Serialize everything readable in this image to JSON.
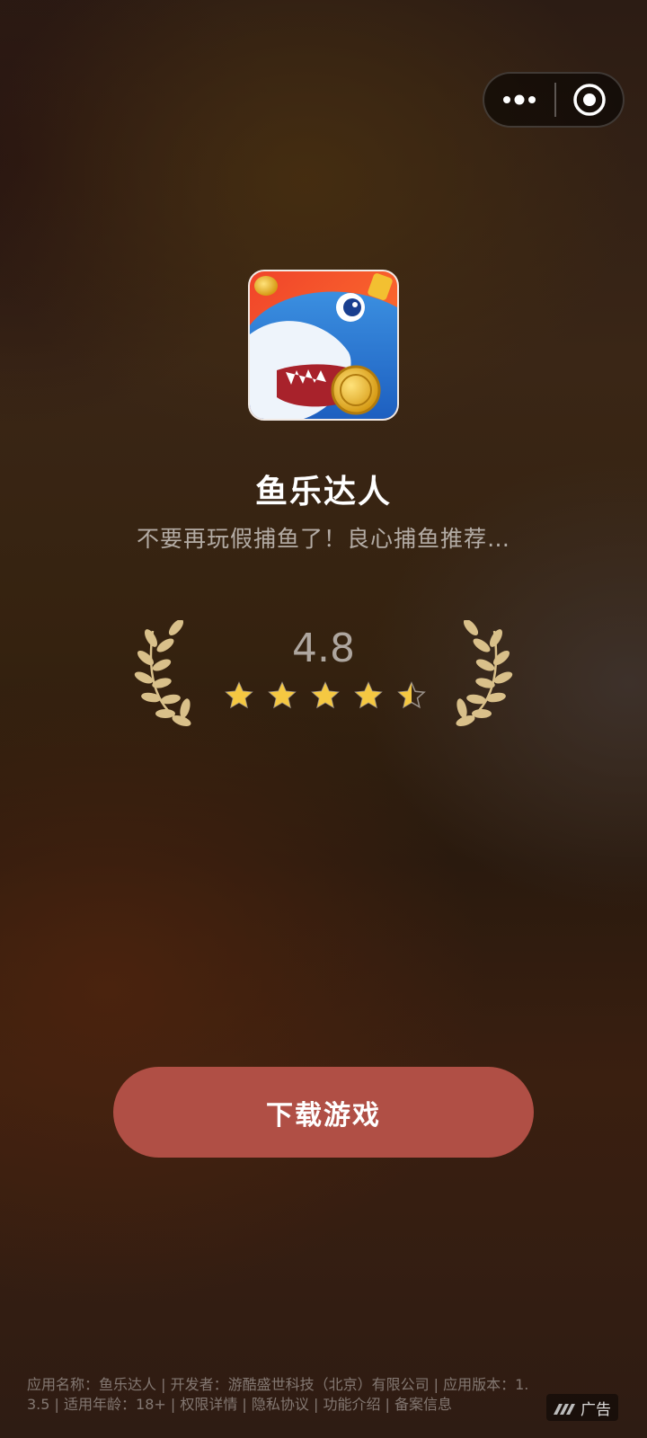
{
  "capsule": {
    "more_icon": "more-dots-icon",
    "close_icon": "target-close-icon"
  },
  "app": {
    "icon": "shark-coin-app-icon",
    "name": "鱼乐达人",
    "description": "不要再玩假捕鱼了！良心捕鱼推荐…"
  },
  "rating": {
    "value": "4.8",
    "stars_filled": 4.5,
    "stars_total": 5,
    "star_color": "#f5c842",
    "laurel_color": "#d9c08a"
  },
  "download": {
    "label": "下载游戏",
    "color": "#b04f45"
  },
  "footer": {
    "text": "应用名称：鱼乐达人 | 开发者：游酷盛世科技（北京）有限公司 | 应用版本：1.3.5 | 适用年龄：18+ | 权限详情 | 隐私协议 | 功能介绍 | 备案信息"
  },
  "ad_badge": {
    "icon": "ad-logo-icon",
    "label": "广告"
  }
}
